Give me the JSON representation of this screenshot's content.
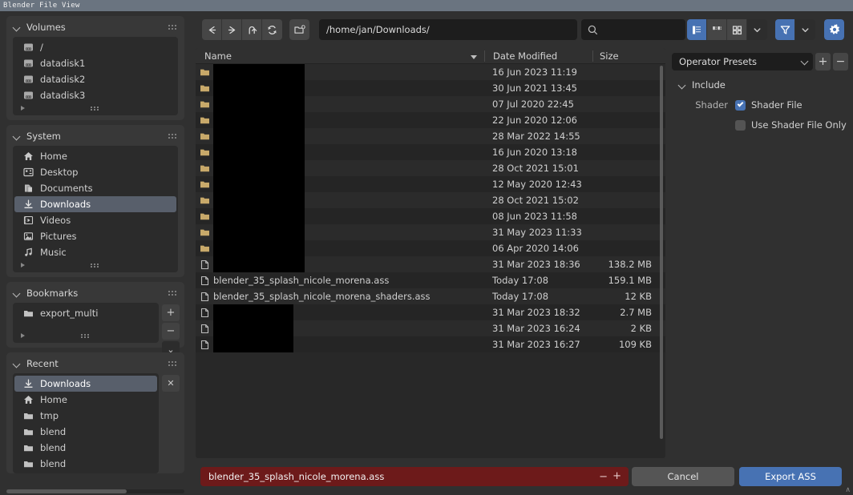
{
  "window": {
    "title": "Blender File View"
  },
  "toolbar": {
    "nav": [
      {
        "name": "back",
        "icon": "arrow-left-icon"
      },
      {
        "name": "forward",
        "icon": "arrow-right-icon"
      },
      {
        "name": "up",
        "icon": "arrow-up-icon"
      },
      {
        "name": "refresh",
        "icon": "refresh-icon"
      }
    ],
    "new_folder_icon": "new-folder-icon",
    "path_value": "/home/jan/Downloads/",
    "search_placeholder": "",
    "search_value": "",
    "display_modes": [
      {
        "name": "vertical-list",
        "active": true
      },
      {
        "name": "horizontal-list",
        "active": false
      },
      {
        "name": "thumbnails",
        "active": false
      }
    ],
    "display_dropdown_icon": "chevron-down-icon",
    "filter_enabled": true,
    "filter_icon": "funnel-icon",
    "filter_dropdown_icon": "chevron-down-icon",
    "settings_icon": "gear-icon",
    "accent": "#4772b3"
  },
  "sidebar": {
    "sections": [
      {
        "title": "Volumes",
        "items": [
          {
            "label": "/",
            "icon": "disk-icon",
            "selected": false
          },
          {
            "label": "datadisk1",
            "icon": "disk-icon",
            "selected": false
          },
          {
            "label": "datadisk2",
            "icon": "disk-icon",
            "selected": false
          },
          {
            "label": "datadisk3",
            "icon": "disk-icon",
            "selected": false
          }
        ],
        "buttons": []
      },
      {
        "title": "System",
        "items": [
          {
            "label": "Home",
            "icon": "home-icon",
            "selected": false
          },
          {
            "label": "Desktop",
            "icon": "desktop-icon",
            "selected": false
          },
          {
            "label": "Documents",
            "icon": "documents-icon",
            "selected": false
          },
          {
            "label": "Downloads",
            "icon": "downloads-icon",
            "selected": true
          },
          {
            "label": "Videos",
            "icon": "videos-icon",
            "selected": false
          },
          {
            "label": "Pictures",
            "icon": "pictures-icon",
            "selected": false
          },
          {
            "label": "Music",
            "icon": "music-icon",
            "selected": false
          }
        ],
        "buttons": []
      },
      {
        "title": "Bookmarks",
        "items": [
          {
            "label": "export_multi",
            "icon": "folder-icon",
            "selected": false
          }
        ],
        "buttons": [
          {
            "name": "add-bookmark-button",
            "glyph": "+"
          },
          {
            "name": "remove-bookmark-button",
            "glyph": "−"
          },
          {
            "name": "bookmark-options-button",
            "glyph": "⌄"
          }
        ]
      },
      {
        "title": "Recent",
        "items": [
          {
            "label": "Downloads",
            "icon": "downloads-icon",
            "selected": true
          },
          {
            "label": "Home",
            "icon": "home-icon",
            "selected": false
          },
          {
            "label": "tmp",
            "icon": "folder-icon",
            "selected": false
          },
          {
            "label": "blend",
            "icon": "folder-icon",
            "selected": false
          },
          {
            "label": "blend",
            "icon": "folder-icon",
            "selected": false
          },
          {
            "label": "blend",
            "icon": "folder-icon",
            "selected": false
          }
        ],
        "buttons": [
          {
            "name": "clear-recent-button",
            "glyph": "✕"
          }
        ]
      }
    ]
  },
  "filelist": {
    "columns": [
      {
        "key": "name",
        "label": "Name",
        "sorted": true,
        "sort_dir": "desc"
      },
      {
        "key": "date",
        "label": "Date Modified"
      },
      {
        "key": "size",
        "label": "Size"
      }
    ],
    "rows": [
      {
        "type": "folder",
        "name": "",
        "redacted": true,
        "redact_width": 114,
        "date": "16 Jun 2023 11:19",
        "size": ""
      },
      {
        "type": "folder",
        "name": "",
        "redacted": true,
        "redact_width": 114,
        "date": "30 Jun 2021 13:45",
        "size": ""
      },
      {
        "type": "folder",
        "name": "",
        "redacted": true,
        "redact_width": 114,
        "date": "07 Jul 2020 22:45",
        "size": ""
      },
      {
        "type": "folder",
        "name": "",
        "redacted": true,
        "redact_width": 114,
        "date": "22 Jun 2020 12:06",
        "size": ""
      },
      {
        "type": "folder",
        "name": "",
        "redacted": true,
        "redact_width": 114,
        "date": "28 Mar 2022 14:55",
        "size": ""
      },
      {
        "type": "folder",
        "name": "",
        "redacted": true,
        "redact_width": 114,
        "date": "16 Jun 2020 13:18",
        "size": ""
      },
      {
        "type": "folder",
        "name": "",
        "redacted": true,
        "redact_width": 114,
        "date": "28 Oct 2021 15:01",
        "size": ""
      },
      {
        "type": "folder",
        "name": "",
        "redacted": true,
        "redact_width": 114,
        "date": "12 May 2020 12:43",
        "size": ""
      },
      {
        "type": "folder",
        "name": "",
        "redacted": true,
        "redact_width": 114,
        "date": "28 Oct 2021 15:02",
        "size": ""
      },
      {
        "type": "folder",
        "name": "",
        "redacted": true,
        "redact_width": 114,
        "date": "08 Jun 2023 11:58",
        "size": ""
      },
      {
        "type": "folder",
        "name": "",
        "redacted": true,
        "redact_width": 114,
        "date": "31 May 2023 11:33",
        "size": ""
      },
      {
        "type": "folder",
        "name": "",
        "redacted": true,
        "redact_width": 114,
        "date": "06 Apr 2020 14:06",
        "size": ""
      },
      {
        "type": "file",
        "name": "",
        "redacted": true,
        "redact_width": 114,
        "date": "31 Mar 2023 18:36",
        "size": "138.2 MB"
      },
      {
        "type": "file",
        "name": "blender_35_splash_nicole_morena.ass",
        "redacted": false,
        "date": "Today 17:08",
        "size": "159.1 MB"
      },
      {
        "type": "file",
        "name": "blender_35_splash_nicole_morena_shaders.ass",
        "redacted": false,
        "date": "Today 17:08",
        "size": "12 KB"
      },
      {
        "type": "file",
        "name": "",
        "redacted": true,
        "redact_width": 100,
        "date": "31 Mar 2023 18:32",
        "size": "2.7 MB"
      },
      {
        "type": "file",
        "name": "",
        "redacted": true,
        "redact_width": 100,
        "date": "31 Mar 2023 16:24",
        "size": "2 KB"
      },
      {
        "type": "file",
        "name": "",
        "redacted": true,
        "redact_width": 100,
        "date": "31 Mar 2023 16:27",
        "size": "109 KB"
      }
    ]
  },
  "rightpanel": {
    "preset": {
      "value": "Operator Presets",
      "add_glyph": "+",
      "remove_glyph": "−"
    },
    "include": {
      "title": "Include",
      "props": [
        {
          "label": "Shader",
          "text": "Shader File",
          "checked": true
        },
        {
          "label": "",
          "text": "Use Shader File Only",
          "checked": false
        }
      ]
    }
  },
  "bottombar": {
    "filename_value": "blender_35_splash_nicole_morena.ass",
    "decrement_glyph": "−",
    "increment_glyph": "+",
    "cancel_label": "Cancel",
    "confirm_label": "Export ASS",
    "filename_bg": "#6d1a1a",
    "corner_glyph": "∧"
  }
}
